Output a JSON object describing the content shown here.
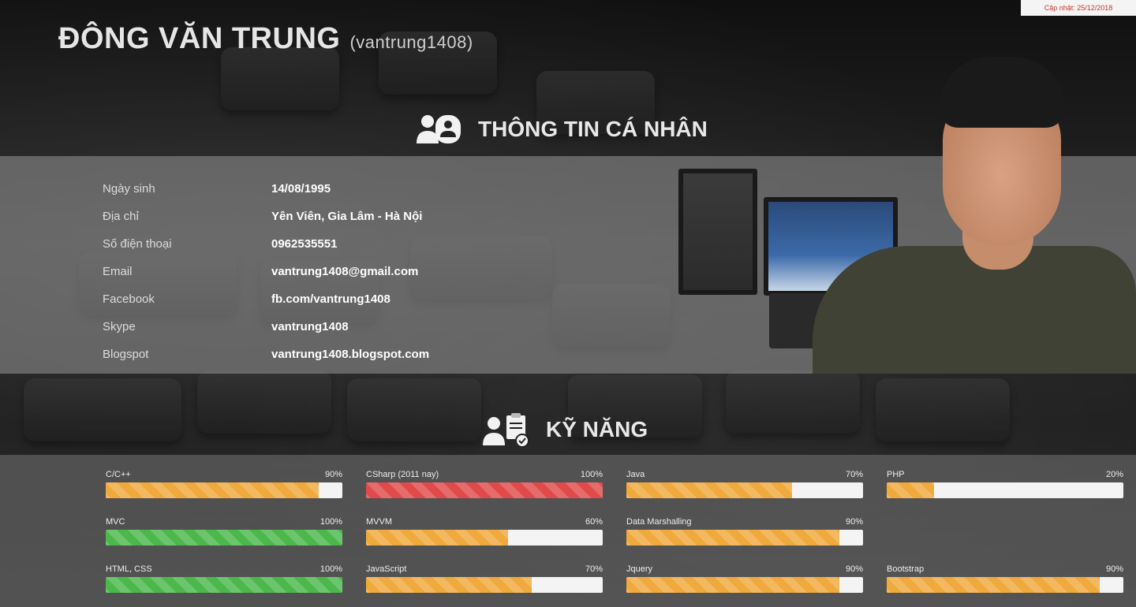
{
  "badge": "Cập nhật: 25/12/2018",
  "profile": {
    "name": "ĐÔNG VĂN TRUNG",
    "nickname": "(vantrung1408)"
  },
  "sections": {
    "info_title": "THÔNG TIN CÁ NHÂN",
    "skills_title": "KỸ NĂNG"
  },
  "info": [
    {
      "label": "Ngày sinh",
      "value": "14/08/1995"
    },
    {
      "label": "Địa chỉ",
      "value": "Yên Viên, Gia Lâm - Hà Nội"
    },
    {
      "label": "Số điện thoại",
      "value": "0962535551"
    },
    {
      "label": "Email",
      "value": "vantrung1408@gmail.com"
    },
    {
      "label": "Facebook",
      "value": "fb.com/vantrung1408"
    },
    {
      "label": "Skype",
      "value": "vantrung1408"
    },
    {
      "label": "Blogspot",
      "value": "vantrung1408.blogspot.com"
    }
  ],
  "skills": [
    {
      "name": "C/C++",
      "percent_label": "90%",
      "percent": 0.9,
      "color": "#f0a93d"
    },
    {
      "name": "CSharp (2011 nay)",
      "percent_label": "100%",
      "percent": 1.0,
      "color": "#e04a4a"
    },
    {
      "name": "Java",
      "percent_label": "70%",
      "percent": 0.7,
      "color": "#f0a93d"
    },
    {
      "name": "PHP",
      "percent_label": "20%",
      "percent": 0.2,
      "color": "#f0a93d"
    },
    {
      "name": "MVC",
      "percent_label": "100%",
      "percent": 1.0,
      "color": "#4cb84c"
    },
    {
      "name": "MVVM",
      "percent_label": "60%",
      "percent": 0.6,
      "color": "#f0a93d"
    },
    {
      "name": "Data Marshalling",
      "percent_label": "90%",
      "percent": 0.9,
      "color": "#f0a93d"
    },
    {
      "name": "",
      "percent_label": "",
      "percent": 0,
      "color": "#f0a93d",
      "empty": true
    },
    {
      "name": "HTML, CSS",
      "percent_label": "100%",
      "percent": 1.0,
      "color": "#4cb84c"
    },
    {
      "name": "JavaScript",
      "percent_label": "70%",
      "percent": 0.7,
      "color": "#f0a93d"
    },
    {
      "name": "Jquery",
      "percent_label": "90%",
      "percent": 0.9,
      "color": "#f0a93d"
    },
    {
      "name": "Bootstrap",
      "percent_label": "90%",
      "percent": 0.9,
      "color": "#f0a93d"
    }
  ],
  "icons": {
    "info_icon": "user-id-card-icon",
    "skills_icon": "user-clipboard-icon"
  }
}
